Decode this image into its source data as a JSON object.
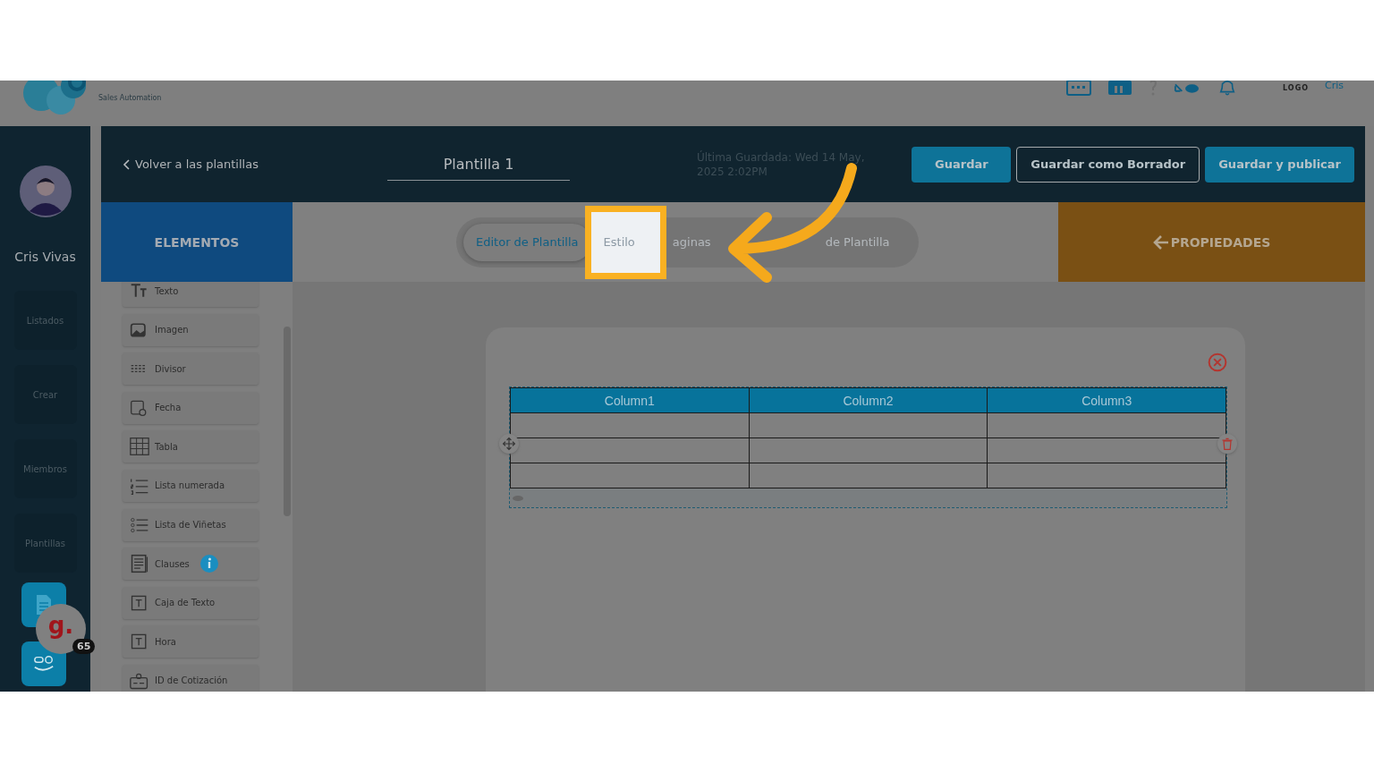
{
  "topbar": {
    "logo_tagline": "Sales Automation",
    "account_logo": "LOGO",
    "user": "Cris"
  },
  "rail": {
    "user_name": "Cris Vivas",
    "items": [
      "Listados",
      "Crear",
      "Miembros",
      "Plantillas"
    ],
    "chat_badge": {
      "label": "g.",
      "count": "65"
    }
  },
  "header": {
    "back": "Volver a las plantillas",
    "title": "Plantilla 1",
    "last_saved": "Última Guardada: Wed 14 May, 2025 2:02PM",
    "buttons": [
      {
        "label": "Guardar",
        "kind": "primary"
      },
      {
        "label": "Guardar como Borrador",
        "kind": "outline"
      },
      {
        "label": "Guardar y publicar",
        "kind": "primary"
      }
    ]
  },
  "elements_tab": "ELEMENTOS",
  "tabs": [
    {
      "label": "Editor de Plantilla",
      "selected": true,
      "highlighted": false
    },
    {
      "label": "Estilo",
      "selected": false,
      "highlighted": true
    },
    {
      "label": "aginas",
      "selected": false,
      "highlighted": false
    },
    {
      "label": "de Plantilla",
      "selected": false,
      "highlighted": false
    }
  ],
  "properties_tab": "PROPIEDADES",
  "elements": [
    {
      "label": "Texto",
      "info": false
    },
    {
      "label": "Imagen",
      "info": false
    },
    {
      "label": "Divisor",
      "info": false
    },
    {
      "label": "Fecha",
      "info": false
    },
    {
      "label": "Tabla",
      "info": false
    },
    {
      "label": "Lista numerada",
      "info": false
    },
    {
      "label": "Lista de Viñetas",
      "info": false
    },
    {
      "label": "Clauses",
      "info": true
    },
    {
      "label": "Caja de Texto",
      "info": false
    },
    {
      "label": "Hora",
      "info": false
    },
    {
      "label": "ID de Cotización",
      "info": false
    }
  ],
  "table": {
    "columns": [
      "Column1",
      "Column2",
      "Column3"
    ]
  }
}
